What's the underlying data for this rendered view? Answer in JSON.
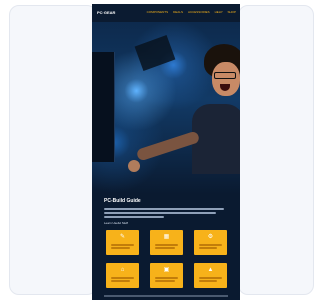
{
  "email": {
    "logo": "PC·GEAR",
    "nav": [
      "COMPONENTS",
      "DEALS",
      "ACCESSORIES",
      "HELP",
      "SHOP"
    ],
    "title": "PC-Build Guide",
    "subhead": "Learn Useful Stuff"
  },
  "tiles": [
    {
      "icon": "pencil-icon"
    },
    {
      "icon": "chip-icon"
    },
    {
      "icon": "gear-icon"
    },
    {
      "icon": "house-icon"
    },
    {
      "icon": "lock-icon"
    },
    {
      "icon": "warning-icon"
    }
  ],
  "colors": {
    "accent": "#f7b21a",
    "background": "#0a1a30"
  }
}
